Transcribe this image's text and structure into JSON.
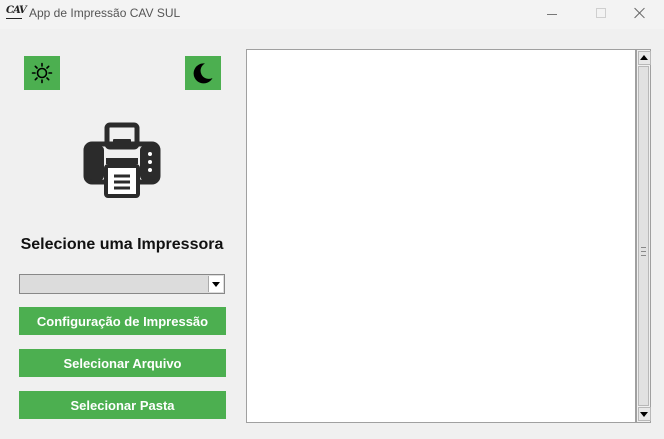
{
  "window": {
    "title": "App de Impressão CAV SUL",
    "icon": "CAV"
  },
  "theme": {
    "light_icon": "sun-icon",
    "dark_icon": "moon-icon",
    "accent": "#4caf50"
  },
  "main": {
    "illustration": "printer-icon",
    "heading": "Selecione uma Impressora",
    "printer_select_value": "",
    "buttons": {
      "print_config": "Configuração de Impressão",
      "select_file": "Selecionar Arquivo",
      "select_folder": "Selecionar Pasta"
    }
  },
  "log": {
    "content": ""
  }
}
